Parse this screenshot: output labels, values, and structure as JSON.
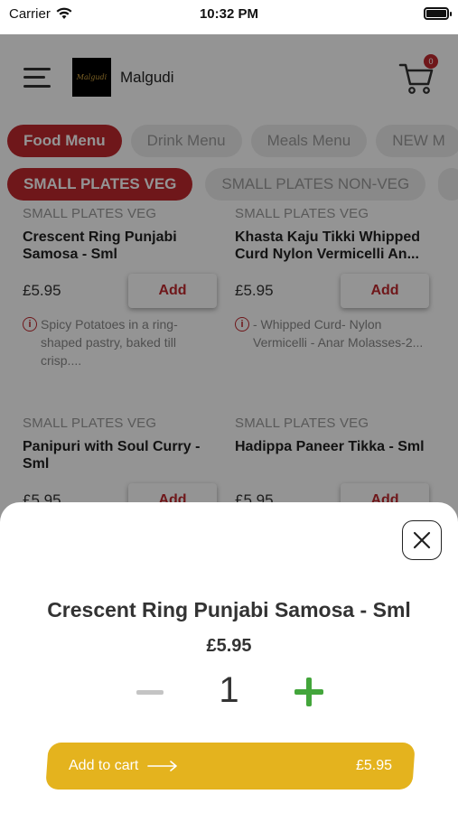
{
  "status_bar": {
    "carrier": "Carrier",
    "time": "10:32 PM"
  },
  "header": {
    "brand_name": "Malgudi",
    "logo_text": "Malgudi",
    "cart_count": "0"
  },
  "menu_tabs": [
    {
      "label": "Food Menu",
      "active": true
    },
    {
      "label": "Drink Menu",
      "active": false
    },
    {
      "label": "Meals Menu",
      "active": false
    },
    {
      "label": "NEW M",
      "active": false
    }
  ],
  "sub_categories": [
    {
      "label": "SMALL PLATES VEG",
      "active": true
    },
    {
      "label": "SMALL PLATES NON-VEG",
      "active": false
    }
  ],
  "products": [
    {
      "category": "SMALL PLATES VEG",
      "name": "Crescent Ring Punjabi Samosa - Sml",
      "price": "£5.95",
      "add_label": "Add",
      "description": "Spicy Potatoes in a ring-shaped pastry, baked till crisp...."
    },
    {
      "category": "SMALL PLATES VEG",
      "name": "Khasta Kaju Tikki Whipped Curd Nylon Vermicelli An...",
      "price": "£5.95",
      "add_label": "Add",
      "description": "- Whipped Curd- Nylon Vermicelli - Anar Molasses-2..."
    },
    {
      "category": "SMALL PLATES VEG",
      "name": "Panipuri with Soul Curry - Sml",
      "price": "£5.95",
      "add_label": "Add",
      "description": ""
    },
    {
      "category": "SMALL PLATES VEG",
      "name": "Hadippa Paneer Tikka - Sml",
      "price": "£5.95",
      "add_label": "Add",
      "description": ""
    }
  ],
  "sheet": {
    "title": "Crescent Ring Punjabi Samosa - Sml",
    "price": "£5.95",
    "quantity": "1",
    "add_to_cart_label": "Add to cart",
    "button_price": "£5.95"
  },
  "colors": {
    "accent_red": "#c0282e",
    "add_green": "#43a53b",
    "cart_yellow": "#e4b31e"
  }
}
